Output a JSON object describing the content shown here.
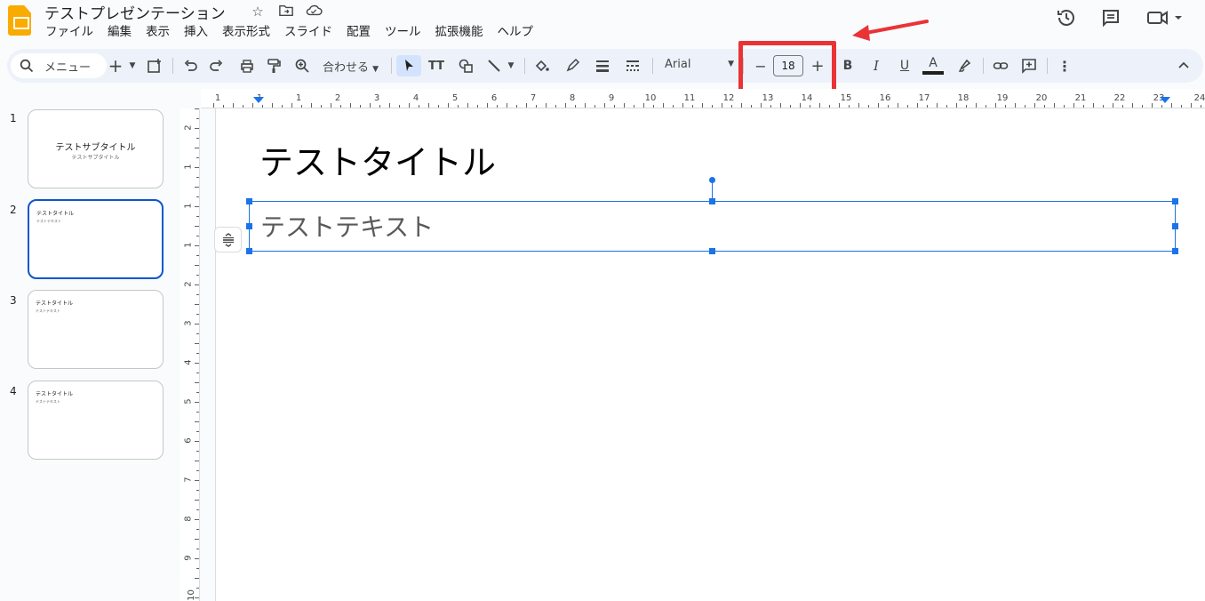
{
  "window": {
    "doc_title": "テストプレゼンテーション"
  },
  "menu": [
    "ファイル",
    "編集",
    "表示",
    "挿入",
    "表示形式",
    "スライド",
    "配置",
    "ツール",
    "拡張機能",
    "ヘルプ"
  ],
  "toolbar": {
    "search_label": "メニュー",
    "zoom_label": "合わせる",
    "font_name": "Arial",
    "font_size": "18",
    "decrease_label": "−",
    "increase_label": "+",
    "bold_label": "B",
    "italic_label": "I",
    "underline_label": "U",
    "text_color_label": "A",
    "tt_label": "TT"
  },
  "ruler": {
    "top_numbers": [
      "1",
      "1",
      "1",
      "2",
      "3",
      "4",
      "5",
      "6",
      "7",
      "8",
      "9",
      "10",
      "11",
      "12",
      "13",
      "14",
      "15",
      "16",
      "17",
      "18",
      "19",
      "20",
      "21",
      "22",
      "23",
      "24"
    ],
    "left_numbers": [
      "2",
      "1",
      "1",
      "1",
      "2",
      "3",
      "4",
      "5",
      "6",
      "7",
      "8",
      "9",
      "10"
    ]
  },
  "slides": [
    {
      "num": "1",
      "title": "テストサブタイトル",
      "body": "テストサブタイトル"
    },
    {
      "num": "2",
      "title": "テストタイトル",
      "body": "テストテキスト"
    },
    {
      "num": "3",
      "title": "テストタイトル",
      "body": "テストテキスト"
    },
    {
      "num": "4",
      "title": "テストタイトル",
      "body": "テストテキスト"
    }
  ],
  "current_slide": {
    "title": "テストタイトル",
    "body": "テストテキスト"
  },
  "colors": {
    "accent": "#1a73e8",
    "annotation": "#ea3337",
    "logo": "#f9ab00"
  }
}
